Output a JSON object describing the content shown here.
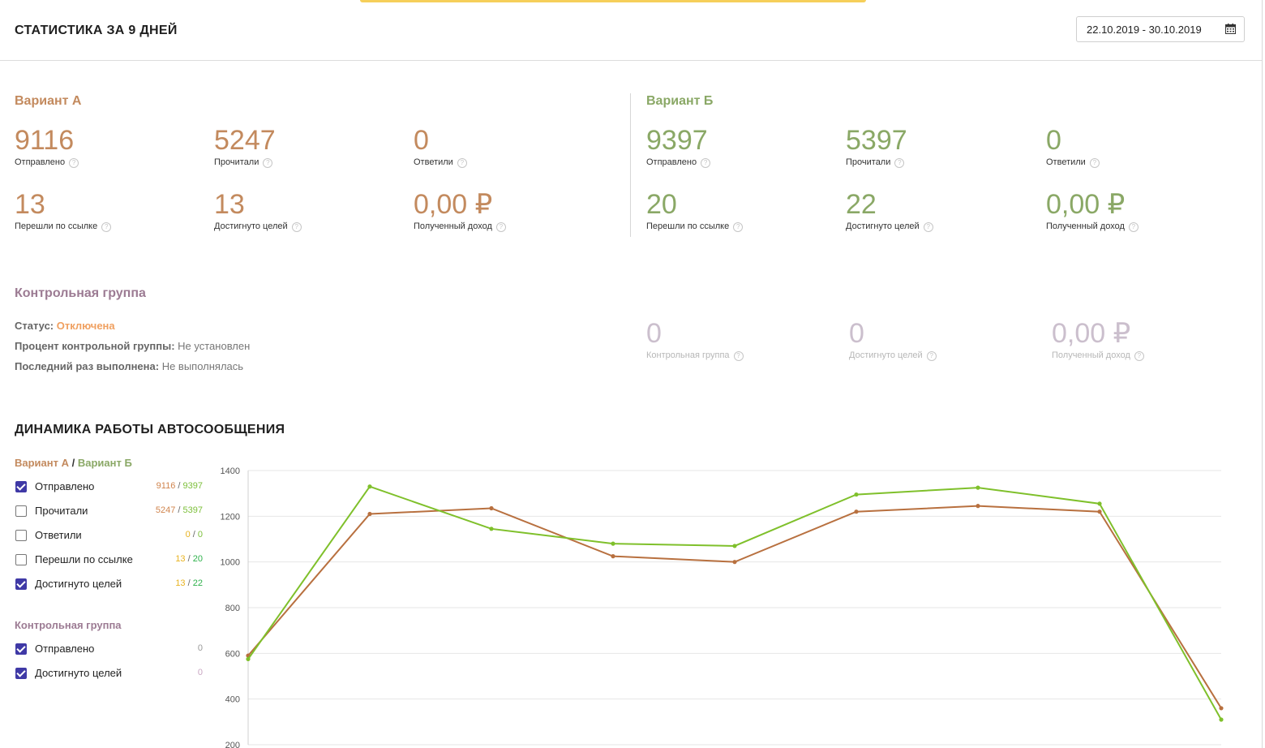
{
  "header": {
    "title": "СТАТИСТИКА ЗА 9 ДНЕЙ",
    "date_range": "22.10.2019 - 30.10.2019"
  },
  "variant_a": {
    "title": "Вариант А",
    "color": "#c38a5e",
    "stats": [
      {
        "value": "9116",
        "label": "Отправлено"
      },
      {
        "value": "5247",
        "label": "Прочитали"
      },
      {
        "value": "0",
        "label": "Ответили"
      },
      {
        "value": "13",
        "label": "Перешли по ссылке"
      },
      {
        "value": "13",
        "label": "Достигнуто целей"
      },
      {
        "value": "0,00 ₽",
        "label": "Полученный доход"
      }
    ]
  },
  "variant_b": {
    "title": "Вариант Б",
    "color": "#8aa866",
    "stats": [
      {
        "value": "9397",
        "label": "Отправлено"
      },
      {
        "value": "5397",
        "label": "Прочитали"
      },
      {
        "value": "0",
        "label": "Ответили"
      },
      {
        "value": "20",
        "label": "Перешли по ссылке"
      },
      {
        "value": "22",
        "label": "Достигнуто целей"
      },
      {
        "value": "0,00 ₽",
        "label": "Полученный доход"
      }
    ]
  },
  "control_group": {
    "title": "Контрольная группа",
    "status_label": "Статус:",
    "status_value": "Отключена",
    "percent_label": "Процент контрольной группы:",
    "percent_value": "Не установлен",
    "last_run_label": "Последний раз выполнена:",
    "last_run_value": "Не выполнялась",
    "stats": [
      {
        "value": "0",
        "label": "Контрольная группа"
      },
      {
        "value": "0",
        "label": "Достигнуто целей"
      },
      {
        "value": "0,00 ₽",
        "label": "Полученный доход"
      }
    ]
  },
  "dynamics": {
    "title": "ДИНАМИКА РАБОТЫ АВТОСООБЩЕНИЯ",
    "legend_a": "Вариант А",
    "legend_sep": "/",
    "legend_b": "Вариант Б",
    "sep": "/",
    "metrics": [
      {
        "label": "Отправлено",
        "checked": true,
        "a": "9116",
        "b": "9397"
      },
      {
        "label": "Прочитали",
        "checked": false,
        "a": "5247",
        "b": "5397"
      },
      {
        "label": "Ответили",
        "checked": false,
        "a": "0",
        "b": "0"
      },
      {
        "label": "Перешли по ссылке",
        "checked": false,
        "a": "13",
        "b": "20"
      },
      {
        "label": "Достигнуто целей",
        "checked": true,
        "a": "13",
        "b": "22"
      }
    ],
    "control_title": "Контрольная группа",
    "control_metrics": [
      {
        "label": "Отправлено",
        "checked": true,
        "value": "0"
      },
      {
        "label": "Достигнуто целей",
        "checked": true,
        "value": "0"
      }
    ]
  },
  "chart_data": {
    "type": "line",
    "x": [
      1,
      2,
      3,
      4,
      5,
      6,
      7,
      8,
      9
    ],
    "ylim": [
      200,
      1400
    ],
    "yticks": [
      200,
      400,
      600,
      800,
      1000,
      1200,
      1400
    ],
    "grid": true,
    "series": [
      {
        "color": "#b8703f",
        "values": [
          590,
          1210,
          1235,
          1025,
          1000,
          1220,
          1245,
          1220,
          360
        ]
      },
      {
        "color": "#7fc02b",
        "values": [
          575,
          1330,
          1145,
          1080,
          1070,
          1295,
          1325,
          1255,
          310
        ]
      }
    ]
  }
}
